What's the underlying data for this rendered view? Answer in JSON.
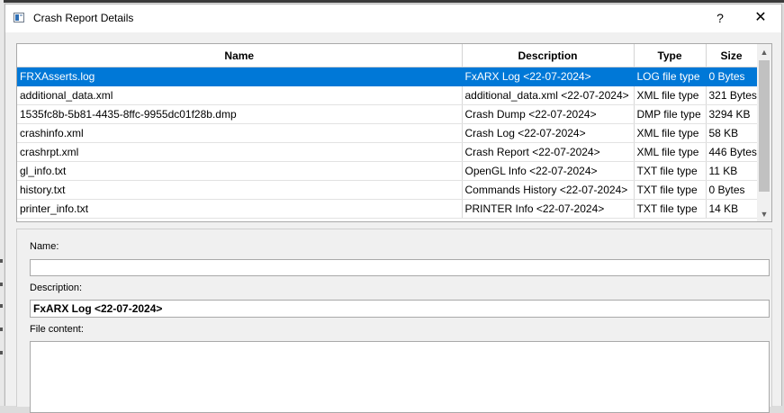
{
  "window": {
    "title": "Crash Report Details",
    "help_label": "?",
    "close_label": "✕"
  },
  "table": {
    "columns": [
      "Name",
      "Description",
      "Type",
      "Size"
    ],
    "rows": [
      {
        "name": "FRXAsserts.log",
        "description": "FxARX Log <22-07-2024>",
        "type": "LOG file type",
        "size": "0 Bytes",
        "selected": true
      },
      {
        "name": "additional_data.xml",
        "description": "additional_data.xml <22-07-2024>",
        "type": "XML file type",
        "size": "321 Bytes",
        "selected": false
      },
      {
        "name": "1535fc8b-5b81-4435-8ffc-9955dc01f28b.dmp",
        "description": "Crash Dump <22-07-2024>",
        "type": "DMP file type",
        "size": "3294 KB",
        "selected": false
      },
      {
        "name": "crashinfo.xml",
        "description": "Crash Log <22-07-2024>",
        "type": "XML file type",
        "size": "58 KB",
        "selected": false
      },
      {
        "name": "crashrpt.xml",
        "description": "Crash Report <22-07-2024>",
        "type": "XML file type",
        "size": "446 Bytes",
        "selected": false
      },
      {
        "name": "gl_info.txt",
        "description": "OpenGL Info <22-07-2024>",
        "type": "TXT file type",
        "size": "11 KB",
        "selected": false
      },
      {
        "name": "history.txt",
        "description": "Commands History <22-07-2024>",
        "type": "TXT file type",
        "size": "0 Bytes",
        "selected": false
      },
      {
        "name": "printer_info.txt",
        "description": "PRINTER Info <22-07-2024>",
        "type": "TXT file type",
        "size": "14 KB",
        "selected": false
      }
    ]
  },
  "details": {
    "name_label": "Name:",
    "name_value": "",
    "description_label": "Description:",
    "description_value": "FxARX Log <22-07-2024>",
    "content_label": "File content:",
    "content_value": ""
  },
  "colors": {
    "selection": "#0078d7",
    "window_bg": "#f0f0f0"
  }
}
